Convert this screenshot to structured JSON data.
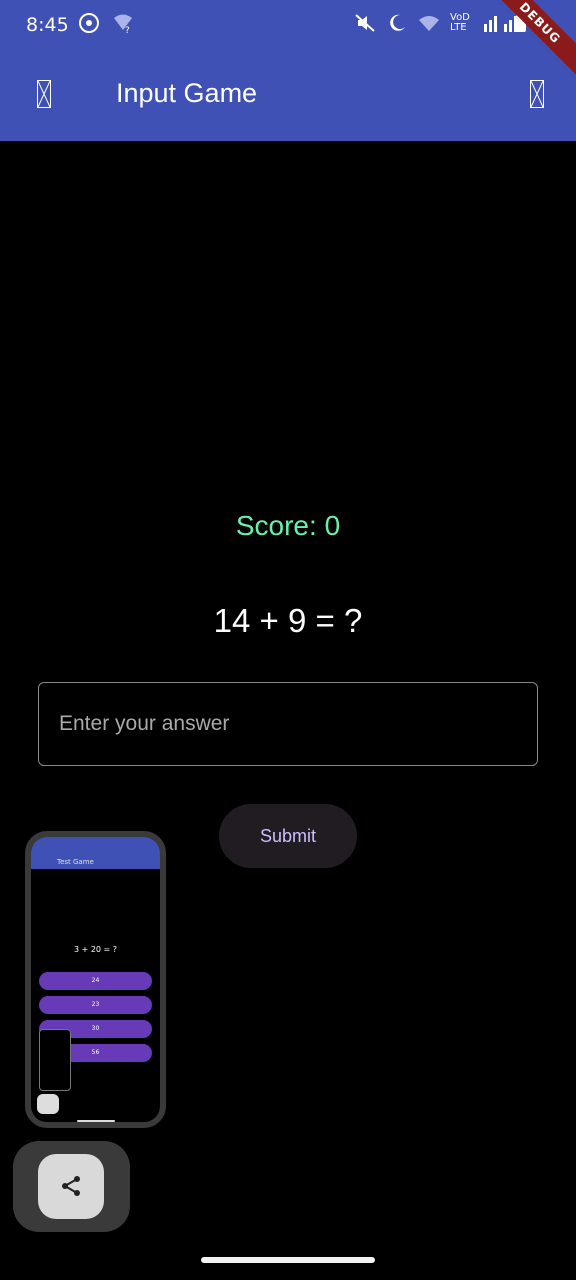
{
  "status_bar": {
    "time": "8:45",
    "network_label": "VoD LTE",
    "icons_left": [
      "whatsapp-icon",
      "wifi-question-icon"
    ],
    "icons_right": [
      "mute-icon",
      "moon-icon",
      "wifi-icon",
      "signal-icon",
      "battery-icon"
    ]
  },
  "app_bar": {
    "title": "Input Game",
    "leading_icon": "missing-glyph-icon",
    "trailing_icon": "missing-glyph-icon",
    "debug_banner": "DEBUG"
  },
  "game": {
    "score_label": "Score: 0",
    "question": "14 + 9 = ?",
    "answer_placeholder": "Enter your answer",
    "submit_label": "Submit"
  },
  "recent_screenshot_preview": {
    "app_title": "Test Game",
    "question": "3 + 20 = ?",
    "options": [
      "24",
      "23",
      "30",
      "56"
    ]
  },
  "colors": {
    "app_bar": "#3f51b5",
    "score": "#69f0ae",
    "submit_text": "#d0bcff",
    "option_bg": "#673ab7"
  }
}
